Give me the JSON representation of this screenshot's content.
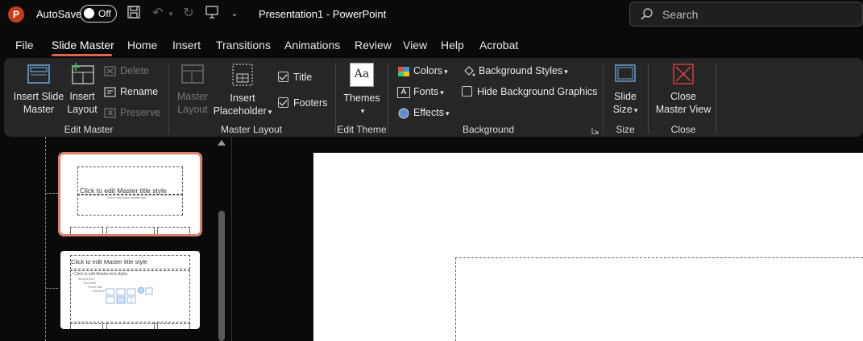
{
  "titlebar": {
    "app_logo": "P",
    "autosave_label": "AutoSave",
    "autosave_state": "Off",
    "doc_title": "Presentation1  -  PowerPoint",
    "search_placeholder": "Search"
  },
  "tabs": [
    "File",
    "Slide Master",
    "Home",
    "Insert",
    "Transitions",
    "Animations",
    "Review",
    "View",
    "Help",
    "Acrobat"
  ],
  "active_tab": "Slide Master",
  "ribbon": {
    "edit_master": {
      "label": "Edit Master",
      "insert_slide_master": [
        "Insert Slide",
        "Master"
      ],
      "insert_layout": [
        "Insert",
        "Layout"
      ],
      "delete": "Delete",
      "rename": "Rename",
      "preserve": "Preserve"
    },
    "master_layout": {
      "label": "Master Layout",
      "master_layout_btn": [
        "Master",
        "Layout"
      ],
      "insert_placeholder": [
        "Insert",
        "Placeholder"
      ],
      "title": "Title",
      "footers": "Footers",
      "title_checked": true,
      "footers_checked": true
    },
    "edit_theme": {
      "label": "Edit Theme",
      "themes": "Themes"
    },
    "background": {
      "label": "Background",
      "colors": "Colors",
      "fonts": "Fonts",
      "effects": "Effects",
      "background_styles": "Background Styles",
      "hide_background_graphics": "Hide Background Graphics"
    },
    "size": {
      "label": "Size",
      "slide_size": [
        "Slide",
        "Size"
      ]
    },
    "close": {
      "label": "Close",
      "close_master_view": [
        "Close",
        "Master View"
      ]
    }
  },
  "thumbnails": {
    "master_title": "Click to edit Master title style",
    "master_subtitle": "Click to edit Master subtitle style",
    "layout_title": "Click to edit Master title style",
    "layout_text": "• Click to edit Master text styles",
    "level2": "Second level",
    "level3": "Third level",
    "level4": "Fourth level",
    "level5": "Fifth level"
  },
  "colors": {
    "accent": "#e0644a",
    "app_logo": "#c43e1c",
    "ribbon_bg": "#262626",
    "window_bg": "#0a0a0a"
  }
}
